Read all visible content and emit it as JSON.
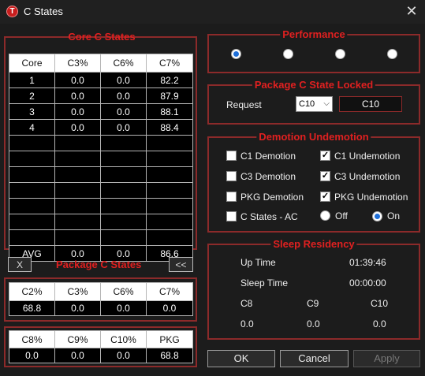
{
  "window": {
    "title": "C States",
    "app_icon": "T"
  },
  "core": {
    "title": "Core C States",
    "headers": [
      "Core",
      "C3%",
      "C6%",
      "C7%"
    ],
    "rows": [
      [
        "1",
        "0.0",
        "0.0",
        "82.2"
      ],
      [
        "2",
        "0.0",
        "0.0",
        "87.9"
      ],
      [
        "3",
        "0.0",
        "0.0",
        "88.1"
      ],
      [
        "4",
        "0.0",
        "0.0",
        "88.4"
      ]
    ],
    "avg": [
      "AVG",
      "0.0",
      "0.0",
      "86.6"
    ]
  },
  "package": {
    "title": "Package C States",
    "x_button": "X",
    "collapse_button": "<<",
    "table1": {
      "headers": [
        "C2%",
        "C3%",
        "C6%",
        "C7%"
      ],
      "values": [
        "68.8",
        "0.0",
        "0.0",
        "0.0"
      ]
    },
    "table2": {
      "headers": [
        "C8%",
        "C9%",
        "C10%",
        "PKG"
      ],
      "values": [
        "0.0",
        "0.0",
        "0.0",
        "68.8"
      ]
    }
  },
  "performance": {
    "title": "Performance",
    "selected_index": 0
  },
  "locked": {
    "title": "Package C State Locked",
    "request_label": "Request",
    "select_value": "C10",
    "value": "C10"
  },
  "demotion": {
    "title": "Demotion Undemotion",
    "items": [
      {
        "label": "C1 Demotion",
        "checked": false
      },
      {
        "label": "C1 Undemotion",
        "checked": true
      },
      {
        "label": "C3 Demotion",
        "checked": false
      },
      {
        "label": "C3 Undemotion",
        "checked": true
      },
      {
        "label": "PKG Demotion",
        "checked": false
      },
      {
        "label": "PKG Undemotion",
        "checked": true
      },
      {
        "label": "C States - AC",
        "checked": false
      }
    ],
    "off_label": "Off",
    "on_label": "On",
    "ac_state": "On"
  },
  "sleep": {
    "title": "Sleep Residency",
    "up_time_label": "Up Time",
    "up_time_value": "01:39:46",
    "sleep_time_label": "Sleep Time",
    "sleep_time_value": "00:00:00",
    "c_headers": [
      "C8",
      "C9",
      "C10"
    ],
    "c_values": [
      "0.0",
      "0.0",
      "0.0"
    ]
  },
  "buttons": {
    "ok": "OK",
    "cancel": "Cancel",
    "apply": "Apply"
  }
}
